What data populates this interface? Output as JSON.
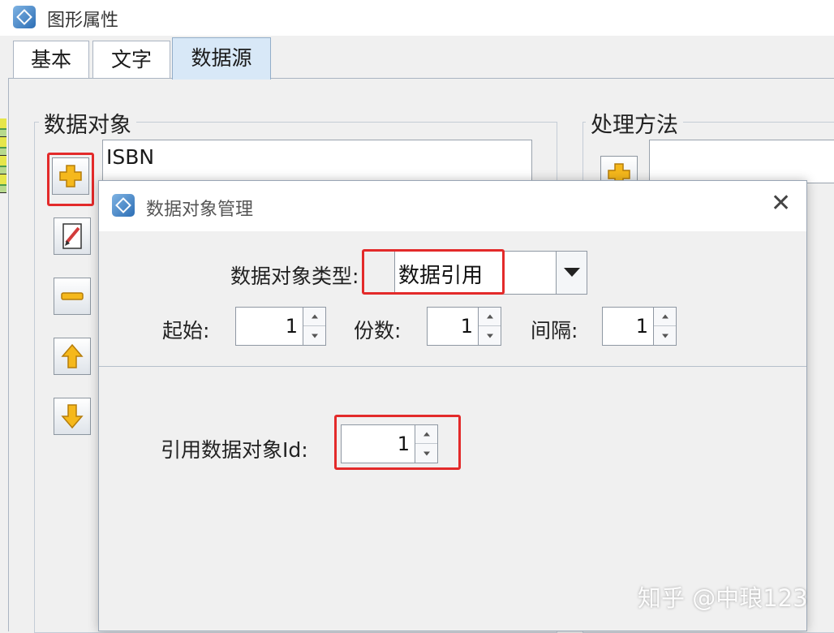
{
  "window": {
    "title": "图形属性"
  },
  "tabs": [
    {
      "label": "基本"
    },
    {
      "label": "文字"
    },
    {
      "label": "数据源"
    }
  ],
  "data_object_group": {
    "label": "数据对象",
    "items": [
      "ISBN"
    ]
  },
  "processing_group": {
    "label": "处理方法"
  },
  "toolbar_icons": [
    "add-icon",
    "edit-icon",
    "remove-icon",
    "move-up-icon",
    "move-down-icon"
  ],
  "dialog": {
    "title": "数据对象管理",
    "close_glyph": "✕",
    "type_label": "数据对象类型:",
    "type_value": "数据引用",
    "start_label": "起始:",
    "start_value": "1",
    "copies_label": "份数:",
    "copies_value": "1",
    "interval_label": "间隔:",
    "interval_value": "1",
    "ref_id_label": "引用数据对象Id:",
    "ref_id_value": "1"
  },
  "watermark": "知乎 @中琅123",
  "colors": {
    "highlight_red": "#e32a2a",
    "icon_yellow": "#f5b81c",
    "active_tab": "#d8e8f7"
  }
}
